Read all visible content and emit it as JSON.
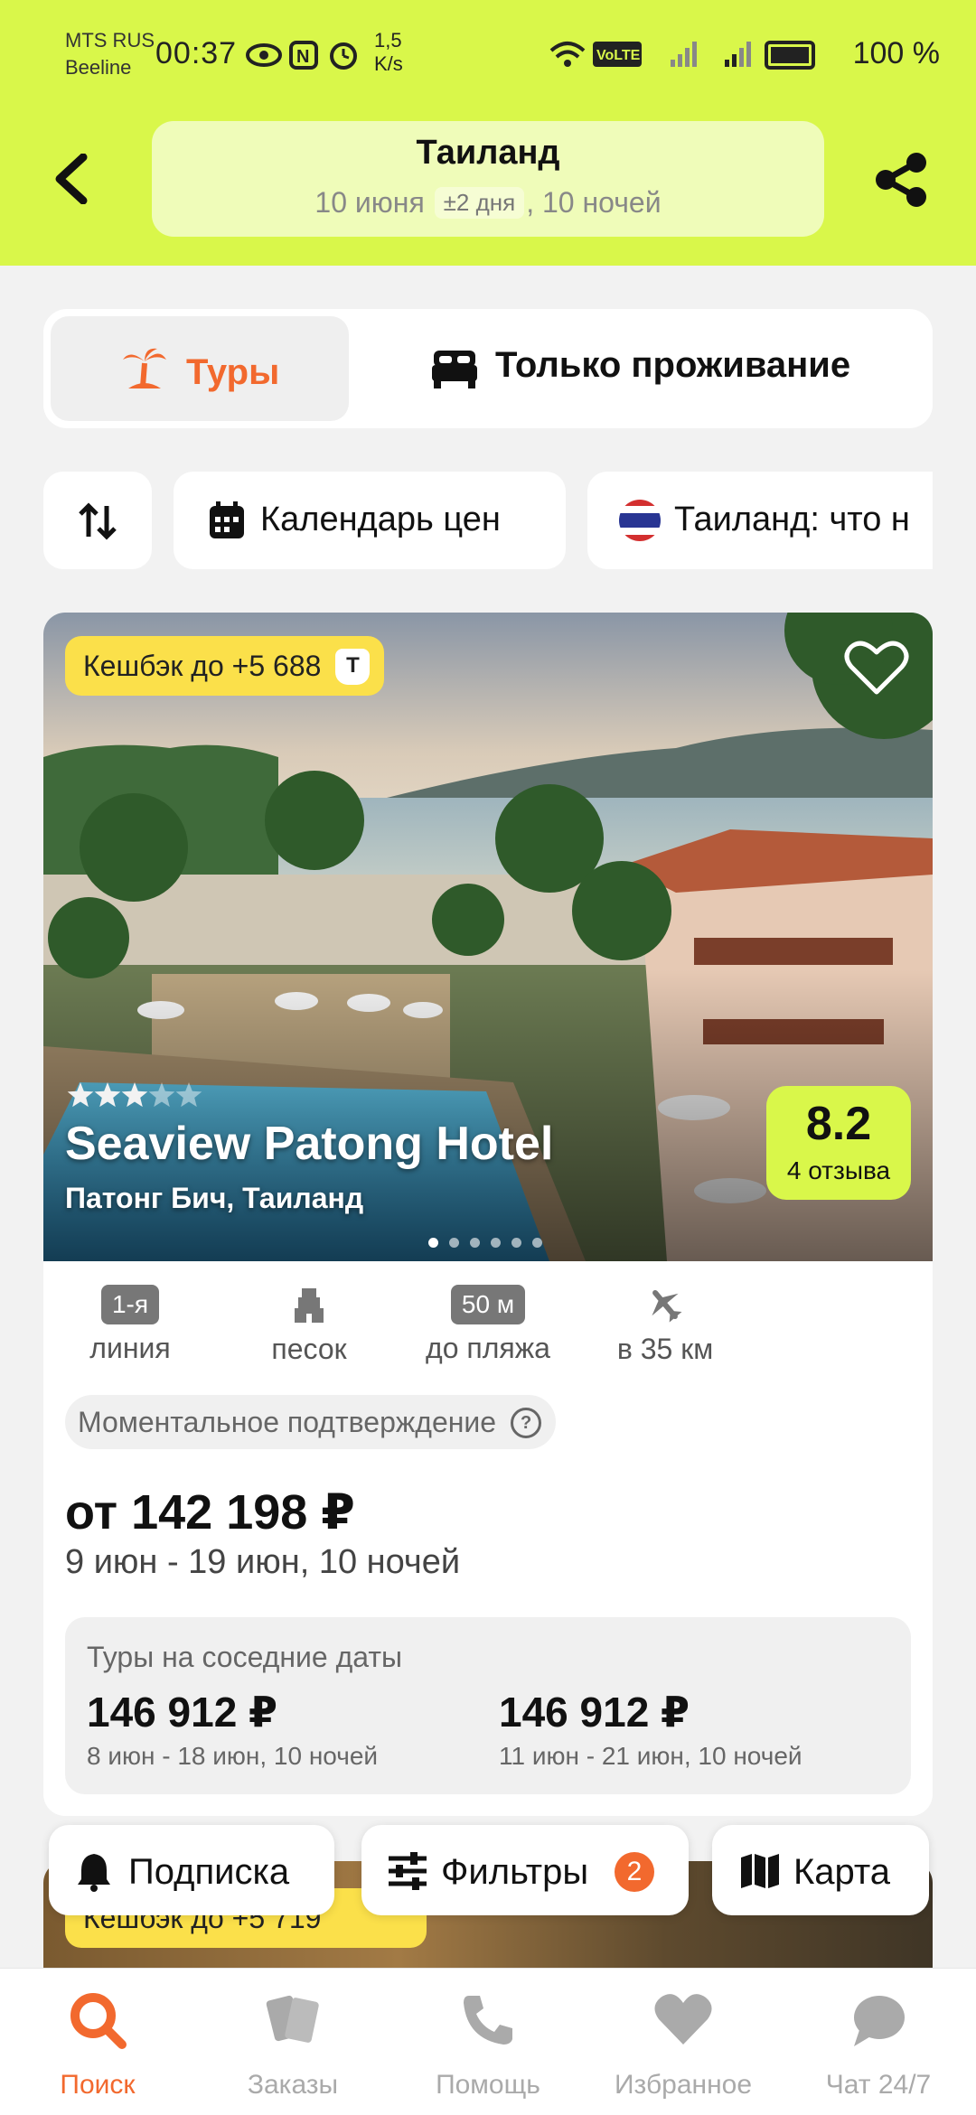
{
  "status_bar": {
    "carrier1": "MTS RUS",
    "carrier2": "Beeline",
    "time": "00:37",
    "speed_value": "1,5",
    "speed_unit": "K/s",
    "battery": "100 %"
  },
  "header": {
    "title": "Таиланд",
    "date": "10 июня",
    "flex": "±2 дня",
    "nights": ", 10 ночей"
  },
  "segments": {
    "tours": "Туры",
    "stay_only": "Только проживание"
  },
  "chips": {
    "calendar": "Календарь цен",
    "country": "Таиланд: что н"
  },
  "card": {
    "cashback": "Кешбэк до +5 688",
    "cashback_badge": "Т",
    "stars": 3,
    "stars_max": 5,
    "hotel_name": "Seaview Patong Hotel",
    "location": "Патонг Бич, Таиланд",
    "rating": "8.2",
    "reviews": "4 отзыва",
    "photo_count": 6,
    "features": [
      {
        "badge": "1-я",
        "label": "линия"
      },
      {
        "icon": "sand-castle-icon",
        "label": "песок"
      },
      {
        "badge": "50 м",
        "label": "до пляжа"
      },
      {
        "icon": "plane-icon",
        "label": "в 35 км"
      }
    ],
    "instant": "Моментальное подтверждение",
    "price": "от 142 198 ₽",
    "dates": "9 июн - 19 июн, 10 ночей",
    "nearby_title": "Туры на соседние даты",
    "nearby": [
      {
        "price": "146 912 ₽",
        "dates": "8 июн - 18 июн, 10 ночей"
      },
      {
        "price": "146 912 ₽",
        "dates": "11 июн - 21 июн, 10 ночей"
      }
    ]
  },
  "next_card": {
    "cashback": "Кешбэк до +5 719"
  },
  "floating": {
    "subscribe": "Подписка",
    "filters": "Фильтры",
    "filters_count": "2",
    "map": "Карта"
  },
  "nav": {
    "search": "Поиск",
    "orders": "Заказы",
    "help": "Помощь",
    "favorites": "Избранное",
    "chat": "Чат 24/7"
  },
  "colors": {
    "accent": "#d9f74a",
    "orange": "#f2692e",
    "cashback": "#fbe04a"
  }
}
